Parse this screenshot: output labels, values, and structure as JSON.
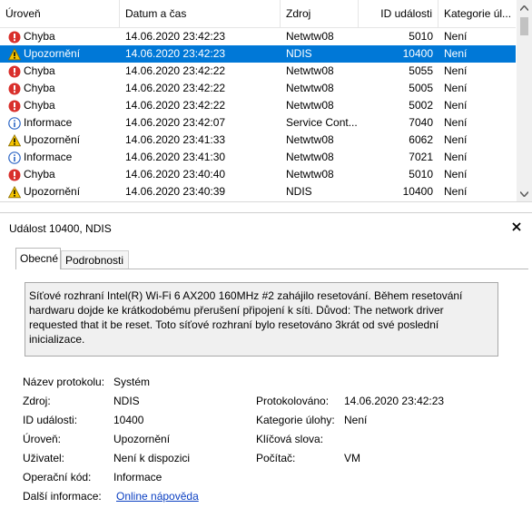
{
  "grid": {
    "columns": {
      "level": "Úroveň",
      "datetime": "Datum a čas",
      "source": "Zdroj",
      "event_id": "ID události",
      "category": "Kategorie úl..."
    },
    "rows": [
      {
        "level": "Chyba",
        "type": "error",
        "datetime": "14.06.2020 23:42:23",
        "source": "Netwtw08",
        "event_id": "5010",
        "category": "Není",
        "selected": false
      },
      {
        "level": "Upozornění",
        "type": "warning",
        "datetime": "14.06.2020 23:42:23",
        "source": "NDIS",
        "event_id": "10400",
        "category": "Není",
        "selected": true
      },
      {
        "level": "Chyba",
        "type": "error",
        "datetime": "14.06.2020 23:42:22",
        "source": "Netwtw08",
        "event_id": "5055",
        "category": "Není",
        "selected": false
      },
      {
        "level": "Chyba",
        "type": "error",
        "datetime": "14.06.2020 23:42:22",
        "source": "Netwtw08",
        "event_id": "5005",
        "category": "Není",
        "selected": false
      },
      {
        "level": "Chyba",
        "type": "error",
        "datetime": "14.06.2020 23:42:22",
        "source": "Netwtw08",
        "event_id": "5002",
        "category": "Není",
        "selected": false
      },
      {
        "level": "Informace",
        "type": "info",
        "datetime": "14.06.2020 23:42:07",
        "source": "Service Cont...",
        "event_id": "7040",
        "category": "Není",
        "selected": false
      },
      {
        "level": "Upozornění",
        "type": "warning",
        "datetime": "14.06.2020 23:41:33",
        "source": "Netwtw08",
        "event_id": "6062",
        "category": "Není",
        "selected": false
      },
      {
        "level": "Informace",
        "type": "info",
        "datetime": "14.06.2020 23:41:30",
        "source": "Netwtw08",
        "event_id": "7021",
        "category": "Není",
        "selected": false
      },
      {
        "level": "Chyba",
        "type": "error",
        "datetime": "14.06.2020 23:40:40",
        "source": "Netwtw08",
        "event_id": "5010",
        "category": "Není",
        "selected": false
      },
      {
        "level": "Upozornění",
        "type": "warning",
        "datetime": "14.06.2020 23:40:39",
        "source": "NDIS",
        "event_id": "10400",
        "category": "Není",
        "selected": false
      }
    ]
  },
  "detail": {
    "title": "Událost 10400, NDIS",
    "tabs": [
      "Obecné",
      "Podrobnosti"
    ],
    "active_tab": "Obecné",
    "message": "Síťové rozhraní Intel(R) Wi-Fi 6 AX200 160MHz #2 zahájilo resetování. Během resetování hardwaru dojde ke krátkodobému přerušení připojení k síti. Důvod: The network driver requested that it be reset. Toto síťové rozhraní bylo resetováno 3krát od své poslední inicializace.",
    "props": {
      "log_name_label": "Název protokolu:",
      "log_name": "Systém",
      "source_label": "Zdroj:",
      "source": "NDIS",
      "logged_label": "Protokolováno:",
      "logged": "14.06.2020 23:42:23",
      "event_id_label": "ID události:",
      "event_id": "10400",
      "task_category_label": "Kategorie úlohy:",
      "task_category": "Není",
      "level_label": "Úroveň:",
      "level": "Upozornění",
      "keywords_label": "Klíčová slova:",
      "user_label": "Uživatel:",
      "user": "Není k dispozici",
      "computer_label": "Počítač:",
      "computer": "VM",
      "opcode_label": "Operační kód:",
      "opcode": "Informace",
      "more_info_label": "Další informace:",
      "more_info_link": "Online nápověda"
    }
  },
  "colors": {
    "selection": "#0078d7",
    "error": "#d9302c",
    "warning": "#f5c400",
    "info": "#2b65c5",
    "link": "#0a3fc2"
  }
}
